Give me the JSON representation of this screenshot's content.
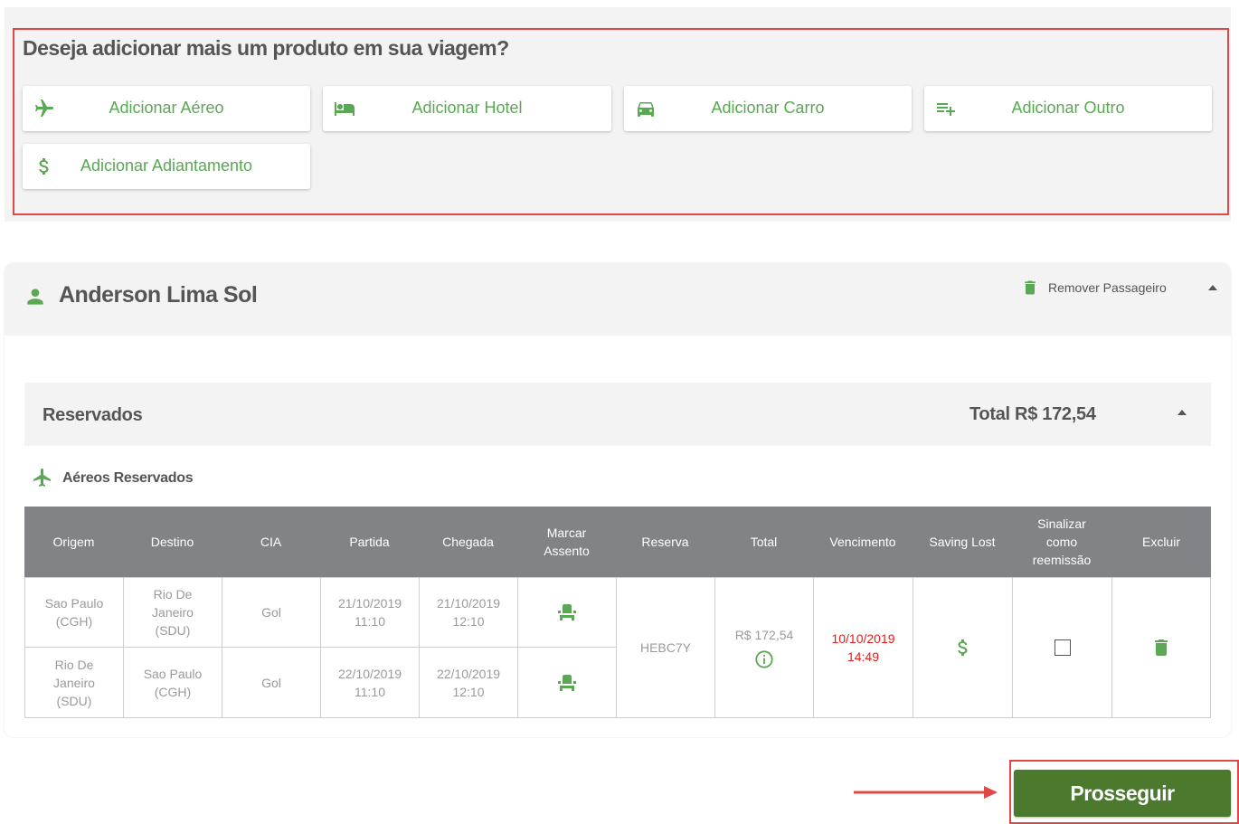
{
  "add_products": {
    "title": "Deseja adicionar mais um produto em sua viagem?",
    "buttons": [
      {
        "label": "Adicionar Aéreo",
        "icon": "airplane-icon"
      },
      {
        "label": "Adicionar Hotel",
        "icon": "hotel-bed-icon"
      },
      {
        "label": "Adicionar Carro",
        "icon": "car-icon"
      },
      {
        "label": "Adicionar Outro",
        "icon": "playlist-add-icon"
      },
      {
        "label": "Adicionar Adiantamento",
        "icon": "dollar-icon"
      }
    ]
  },
  "passenger": {
    "name": "Anderson Lima Sol",
    "remove_label": "Remover Passageiro"
  },
  "reserved": {
    "title": "Reservados",
    "total": "Total R$ 172,54",
    "flights_label": "Aéreos Reservados"
  },
  "table": {
    "headers": [
      "Origem",
      "Destino",
      "CIA",
      "Partida",
      "Chegada",
      "Marcar\nAssento",
      "Reserva",
      "Total",
      "Vencimento",
      "Saving Lost",
      "Sinalizar\ncomo\nreemissão",
      "Excluir"
    ],
    "legs": [
      {
        "origem": "Sao Paulo\n(CGH)",
        "destino": "Rio De\nJaneiro\n(SDU)",
        "cia": "Gol",
        "partida": "21/10/2019\n11:10",
        "chegada": "21/10/2019\n12:10"
      },
      {
        "origem": "Rio De\nJaneiro\n(SDU)",
        "destino": "Sao Paulo\n(CGH)",
        "cia": "Gol",
        "partida": "22/10/2019\n11:10",
        "chegada": "22/10/2019\n12:10"
      }
    ],
    "reserva": "HEBC7Y",
    "total": "R$ 172,54",
    "vencimento": "10/10/2019\n14:49"
  },
  "footer": {
    "next_label": "Prosseguir"
  },
  "colors": {
    "accent_green": "#5aa854",
    "button_green": "#4b7a2f",
    "highlight_red": "#e04848",
    "header_gray": "#828387",
    "due_red": "#e31d1d"
  }
}
